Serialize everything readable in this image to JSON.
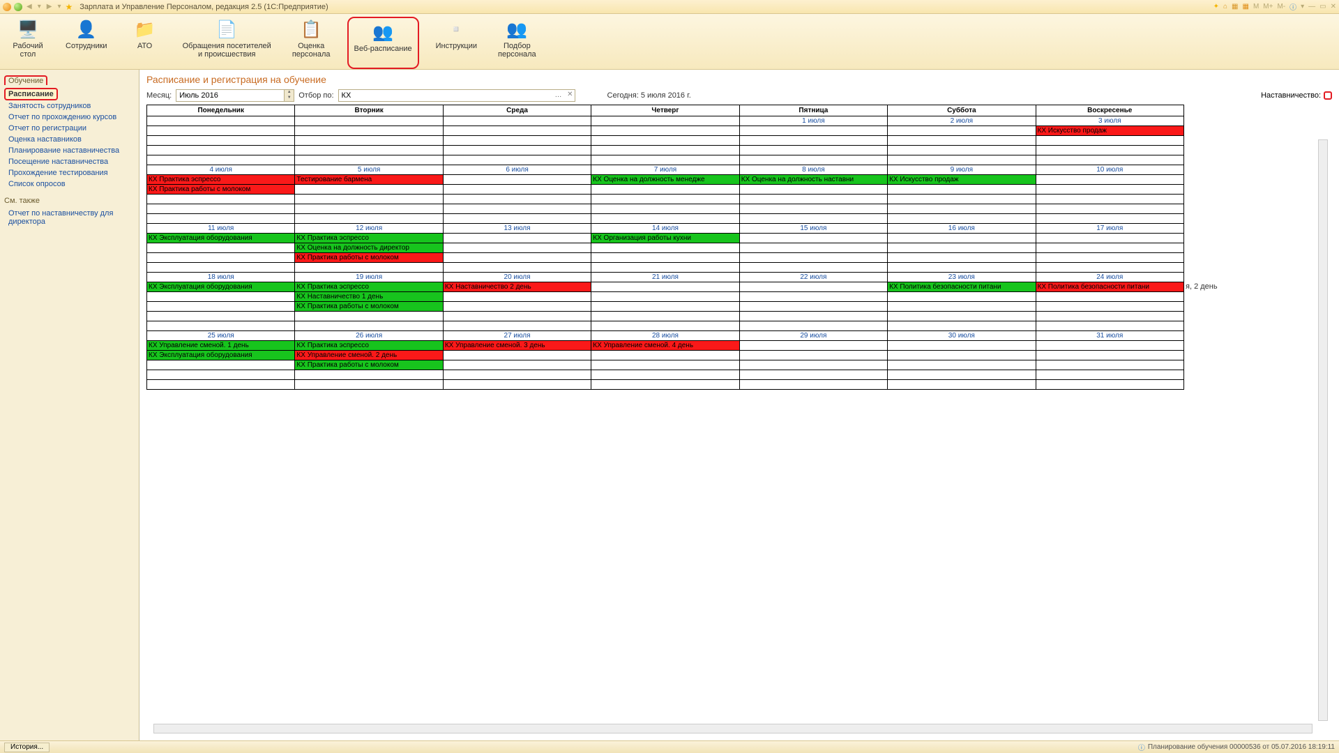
{
  "window": {
    "title": "Зарплата и Управление Персоналом, редакция 2.5  (1С:Предприятие)"
  },
  "titlebar_right": [
    "M",
    "M+",
    "M-"
  ],
  "toolbar": [
    {
      "id": "desktop",
      "label": "Рабочий\nстол",
      "icon": "🖥️"
    },
    {
      "id": "employees",
      "label": "Сотрудники",
      "icon": "👤"
    },
    {
      "id": "ato",
      "label": "АТО",
      "icon": "📁"
    },
    {
      "id": "requests",
      "label": "Обращения посетителей\nи происшествия",
      "icon": "📄"
    },
    {
      "id": "appraisal",
      "label": "Оценка\nперсонала",
      "icon": "📋"
    },
    {
      "id": "websched",
      "label": "Веб-расписание",
      "icon": "👥",
      "highlight": true
    },
    {
      "id": "instructions",
      "label": "Инструкции",
      "icon": "▫️"
    },
    {
      "id": "recruit",
      "label": "Подбор\nперсонала",
      "icon": "👥"
    }
  ],
  "sidebar": {
    "section1": "Обучение",
    "links1": [
      {
        "text": "Расписание",
        "highlight": true
      },
      {
        "text": "Занятость сотрудников"
      },
      {
        "text": "Отчет по прохождению курсов"
      },
      {
        "text": "Отчет по регистрации"
      },
      {
        "text": "Оценка наставников"
      },
      {
        "text": "Планирование наставничества"
      },
      {
        "text": "Посещение наставничества"
      },
      {
        "text": "Прохождение тестирования"
      },
      {
        "text": "Список опросов"
      }
    ],
    "section2": "См. также",
    "links2": [
      {
        "text": "Отчет по наставничеству для директора"
      }
    ]
  },
  "page": {
    "header": "Расписание и регистрация на обучение",
    "month_label": "Месяц:",
    "month_value": "Июль 2016",
    "filter_label": "Отбор по:",
    "filter_value": "КХ",
    "today": "Сегодня: 5 июля 2016 г.",
    "mentoring_label": "Наставничество:"
  },
  "schedule": {
    "days": [
      "Понедельник",
      "Вторник",
      "Среда",
      "Четверг",
      "Пятница",
      "Суббота",
      "Воскресенье"
    ],
    "weeks": [
      {
        "dates": [
          "",
          "",
          "",
          "",
          "1 июля",
          "2 июля",
          "3 июля"
        ],
        "rows": [
          [
            null,
            null,
            null,
            null,
            null,
            null,
            {
              "t": "КХ Искусство продаж",
              "c": "red"
            }
          ],
          [
            null,
            null,
            null,
            null,
            null,
            null,
            null
          ],
          [
            null,
            null,
            null,
            null,
            null,
            null,
            null
          ],
          [
            null,
            null,
            null,
            null,
            null,
            null,
            null
          ]
        ]
      },
      {
        "dates": [
          "4 июля",
          "5 июля",
          "6 июля",
          "7 июля",
          "8 июля",
          "9 июля",
          "10 июля"
        ],
        "rows": [
          [
            {
              "t": "КХ Практика эспрессо",
              "c": "red"
            },
            {
              "t": "Тестирование бармена",
              "c": "red"
            },
            null,
            {
              "t": "КХ Оценка на должность менедже",
              "c": "green"
            },
            {
              "t": "КХ Оценка на должность наставни",
              "c": "green"
            },
            {
              "t": "КХ Искусство продаж",
              "c": "green"
            },
            null
          ],
          [
            {
              "t": "КХ Практика работы с молоком",
              "c": "red"
            },
            null,
            null,
            null,
            null,
            null,
            null
          ],
          [
            null,
            null,
            null,
            null,
            null,
            null,
            null
          ],
          [
            null,
            null,
            null,
            null,
            null,
            null,
            null
          ],
          [
            null,
            null,
            null,
            null,
            null,
            null,
            null
          ]
        ]
      },
      {
        "dates": [
          "11 июля",
          "12 июля",
          "13 июля",
          "14 июля",
          "15 июля",
          "16 июля",
          "17 июля"
        ],
        "rows": [
          [
            {
              "t": "КХ Эксплуатация оборудования",
              "c": "green"
            },
            {
              "t": "КХ Практика эспрессо",
              "c": "green"
            },
            null,
            {
              "t": "КХ Организация работы кухни",
              "c": "green"
            },
            null,
            null,
            null
          ],
          [
            null,
            {
              "t": "КХ Оценка на должность директор",
              "c": "green"
            },
            null,
            null,
            null,
            null,
            null
          ],
          [
            null,
            {
              "t": "КХ Практика работы с молоком",
              "c": "red"
            },
            null,
            null,
            null,
            null,
            null
          ],
          [
            null,
            null,
            null,
            null,
            null,
            null,
            null
          ]
        ]
      },
      {
        "dates": [
          "18 июля",
          "19 июля",
          "20 июля",
          "21 июля",
          "22 июля",
          "23 июля",
          "24 июля"
        ],
        "rows": [
          [
            {
              "t": "КХ Эксплуатация оборудования",
              "c": "green"
            },
            {
              "t": "КХ Практика эспрессо",
              "c": "green"
            },
            {
              "t": "КХ Наставничество 2 день",
              "c": "red"
            },
            null,
            null,
            {
              "t": "КХ Политика безопасности питани",
              "c": "green"
            },
            {
              "t": "КХ Политика безопасности питани",
              "c": "red"
            }
          ],
          [
            null,
            {
              "t": "КХ Наставничество 1 день",
              "c": "green"
            },
            null,
            null,
            null,
            null,
            null
          ],
          [
            null,
            {
              "t": "КХ Практика работы с молоком",
              "c": "green"
            },
            null,
            null,
            null,
            null,
            null
          ],
          [
            null,
            null,
            null,
            null,
            null,
            null,
            null
          ],
          [
            null,
            null,
            null,
            null,
            null,
            null,
            null
          ]
        ]
      },
      {
        "dates": [
          "25 июля",
          "26 июля",
          "27 июля",
          "28 июля",
          "29 июля",
          "30 июля",
          "31 июля"
        ],
        "rows": [
          [
            {
              "t": "КХ Управление сменой. 1 день",
              "c": "green"
            },
            {
              "t": "КХ Практика эспрессо",
              "c": "green"
            },
            {
              "t": "КХ Управление сменой. 3 день",
              "c": "red"
            },
            {
              "t": "КХ Управление сменой. 4 день",
              "c": "red"
            },
            null,
            null,
            null
          ],
          [
            {
              "t": "КХ Эксплуатация оборудования",
              "c": "green"
            },
            {
              "t": "КХ Управление сменой. 2 день",
              "c": "red"
            },
            null,
            null,
            null,
            null,
            null
          ],
          [
            null,
            {
              "t": "КХ Практика работы с молоком",
              "c": "green"
            },
            null,
            null,
            null,
            null,
            null
          ],
          [
            null,
            null,
            null,
            null,
            null,
            null,
            null
          ],
          [
            null,
            null,
            null,
            null,
            null,
            null,
            null
          ]
        ]
      }
    ],
    "overflow_text": "я, 2 день"
  },
  "statusbar": {
    "history": "История...",
    "status": "Планирование обучения 00000536 от 05.07.2016 18:19:11"
  }
}
